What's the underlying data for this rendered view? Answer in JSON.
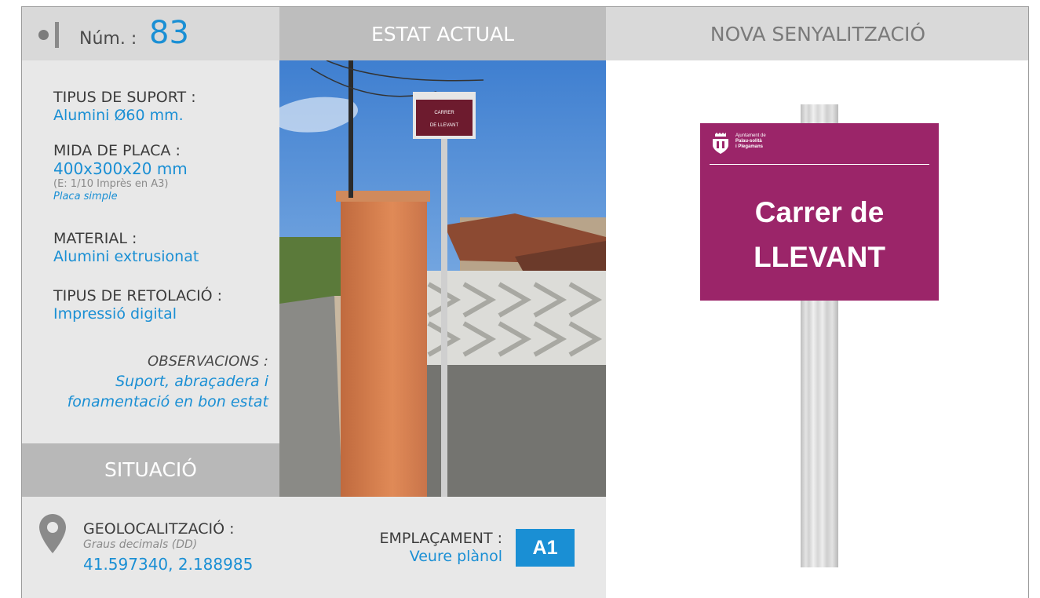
{
  "header": {
    "num_label": "Núm. :",
    "num_value": "83",
    "estat_actual": "ESTAT ACTUAL",
    "nova_senyalitzacio": "NOVA SENYALITZACIÓ"
  },
  "fields": {
    "tipus_suport_label": "TIPUS DE SUPORT :",
    "tipus_suport_value": "Alumini Ø60 mm.",
    "mida_placa_label": "MIDA DE PLACA :",
    "mida_placa_value": "400x300x20 mm",
    "mida_placa_note": "(E: 1/10 Imprès en A3)",
    "mida_placa_type": "Placa simple",
    "material_label": "MATERIAL :",
    "material_value": "Alumini extrusionat",
    "retolacio_label": "TIPUS DE RETOLACIÓ :",
    "retolacio_value": "Impressió digital",
    "observacions_label": "OBSERVACIONS :",
    "observacions_line1": "Suport, abraçadera i",
    "observacions_line2": "fonamentació en bon estat"
  },
  "situacio": {
    "title": "SITUACIÓ",
    "geo_label": "GEOLOCALITZACIÓ :",
    "geo_sub": "Graus decimals (DD)",
    "geo_value": "41.597340, 2.188985",
    "emplacament_label": "EMPLAÇAMENT :",
    "emplacament_value": "Veure plànol",
    "badge": "A1"
  },
  "photo": {
    "sign_line1": "CARRER",
    "sign_line2": "DE LLEVANT"
  },
  "new_sign": {
    "logo_line1": "Ajuntament de",
    "logo_line2": "Palau-solità",
    "logo_line3": "i Plegamans",
    "text_line1": "Carrer de",
    "text_line2": "LLEVANT",
    "color": "#9b2569"
  },
  "colors": {
    "accent": "#1a8fd4",
    "panel": "#e8e8e8",
    "header_gray": "#bdbdbd"
  }
}
